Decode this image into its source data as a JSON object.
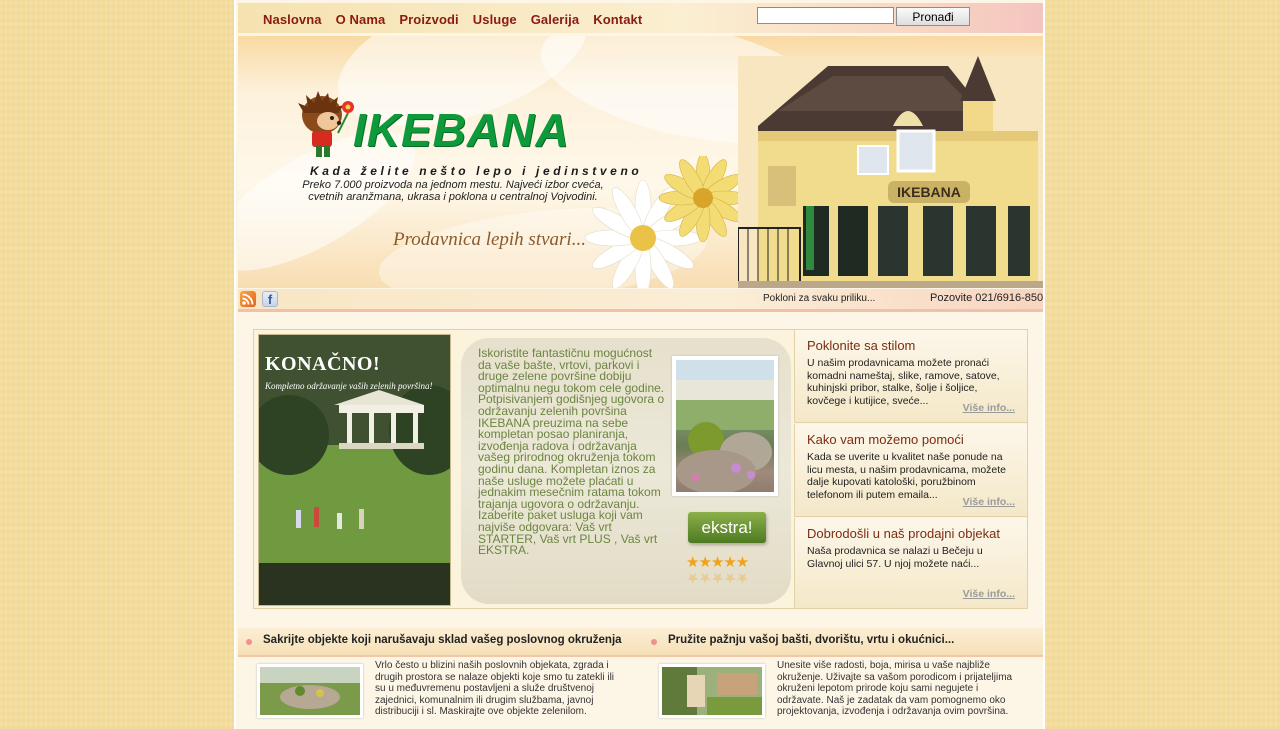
{
  "nav": {
    "items": [
      "Naslovna",
      "O Nama",
      "Proizvodi",
      "Usluge",
      "Galerija",
      "Kontakt"
    ],
    "search_button": "Pronađi",
    "search_value": ""
  },
  "banner": {
    "logo_text": "IKEBANA",
    "tagline": "Kada želite nešto lepo i jedinstveno",
    "description": "Preko 7.000 proizvoda na jednom mestu. Najveći izbor cveća, cvetnih aranžmana, ukrasa i poklona u centralnoj Vojvodini.",
    "slogan": "Prodavnica lepih stvari...",
    "building_sign": "IKEBANA"
  },
  "infobar": {
    "gift_text": "Pokloni za svaku priliku...",
    "phone_text": "Pozovite 021/6916-850"
  },
  "promo": {
    "poster_title": "KONAČNO!",
    "poster_subtitle": "Kompletno održavanje vaših zelenih površina!",
    "text": "Iskoristite fantastičnu mogućnost da vaše bašte, vrtovi, parkovi i druge zelene površine dobiju optimalnu negu tokom cele godine. Potpisivanjem godišnjeg ugovora o održavanju zelenih površina IKEBANA preuzima na sebe kompletan posao planiranja, izvođenja radova i održavanja vašeg prirodnog okruženja tokom godinu dana. Kompletan iznos za naše usluge možete plaćati u jednakim mesečnim ratama tokom trajanja ugovora o održavanju. Izaberite paket usluga koji vam najviše odgovara: Vaš vrt STARTER, Vaš vrt PLUS , Vaš vrt EKSTRA.",
    "badge": "ekstra!",
    "stars": "★★★★★"
  },
  "side": [
    {
      "title": "Poklonite sa stilom",
      "body": "U našim prodavnicama možete pronaći komadni nameštaj, slike, ramove, satove, kuhinjski pribor, stalke, šolje i šoljice, kovčege i kutijice, sveće...",
      "more": "Više info..."
    },
    {
      "title": "Kako vam možemo pomoći",
      "body": "Kada se uverite u kvalitet naše ponude na licu mesta, u našim prodavnicama, možete dalje kupovati katološki, poružbinom telefonom ili putem emaila...",
      "more": "Više info..."
    },
    {
      "title": "Dobrodošli u naš prodajni objekat",
      "body": "Naša prodavnica se nalazi u Bečeju u Glavnoj ulici 57. U njoj možete naći...",
      "more": "Više info..."
    }
  ],
  "bottom": [
    {
      "heading": "Sakrijte objekte koji narušavaju sklad vašeg poslovnog okruženja",
      "text": "Vrlo često u blizini naših poslovnih objekata, zgrada i drugih prostora se nalaze objekti koje smo tu zatekli ili su u međuvremenu postavljeni a služe društvenoj zajednici, komunalnim ili drugim službama, javnoj distribuciji i sl. Maskirajte ove objekte zelenilom."
    },
    {
      "heading": "Pružite pažnju vašoj bašti, dvorištu, vrtu i okućnici...",
      "text": "Unesite više radosti, boja, mirisa u vaše najbliže okruženje. Uživajte sa vašom porodicom i prijateljima okruženi lepotom prirode koju sami negujete i održavate. Naš je zadatak da vam pomognemo oko projektovanja, izvođenja i održavanja ovim površina."
    }
  ],
  "colors": {
    "page_bg": "#f3dc9c",
    "nav_text": "#8a1a12",
    "logo_green": "#0e9a3b",
    "promo_text": "#6b8540",
    "side_title": "#7b2d12"
  }
}
